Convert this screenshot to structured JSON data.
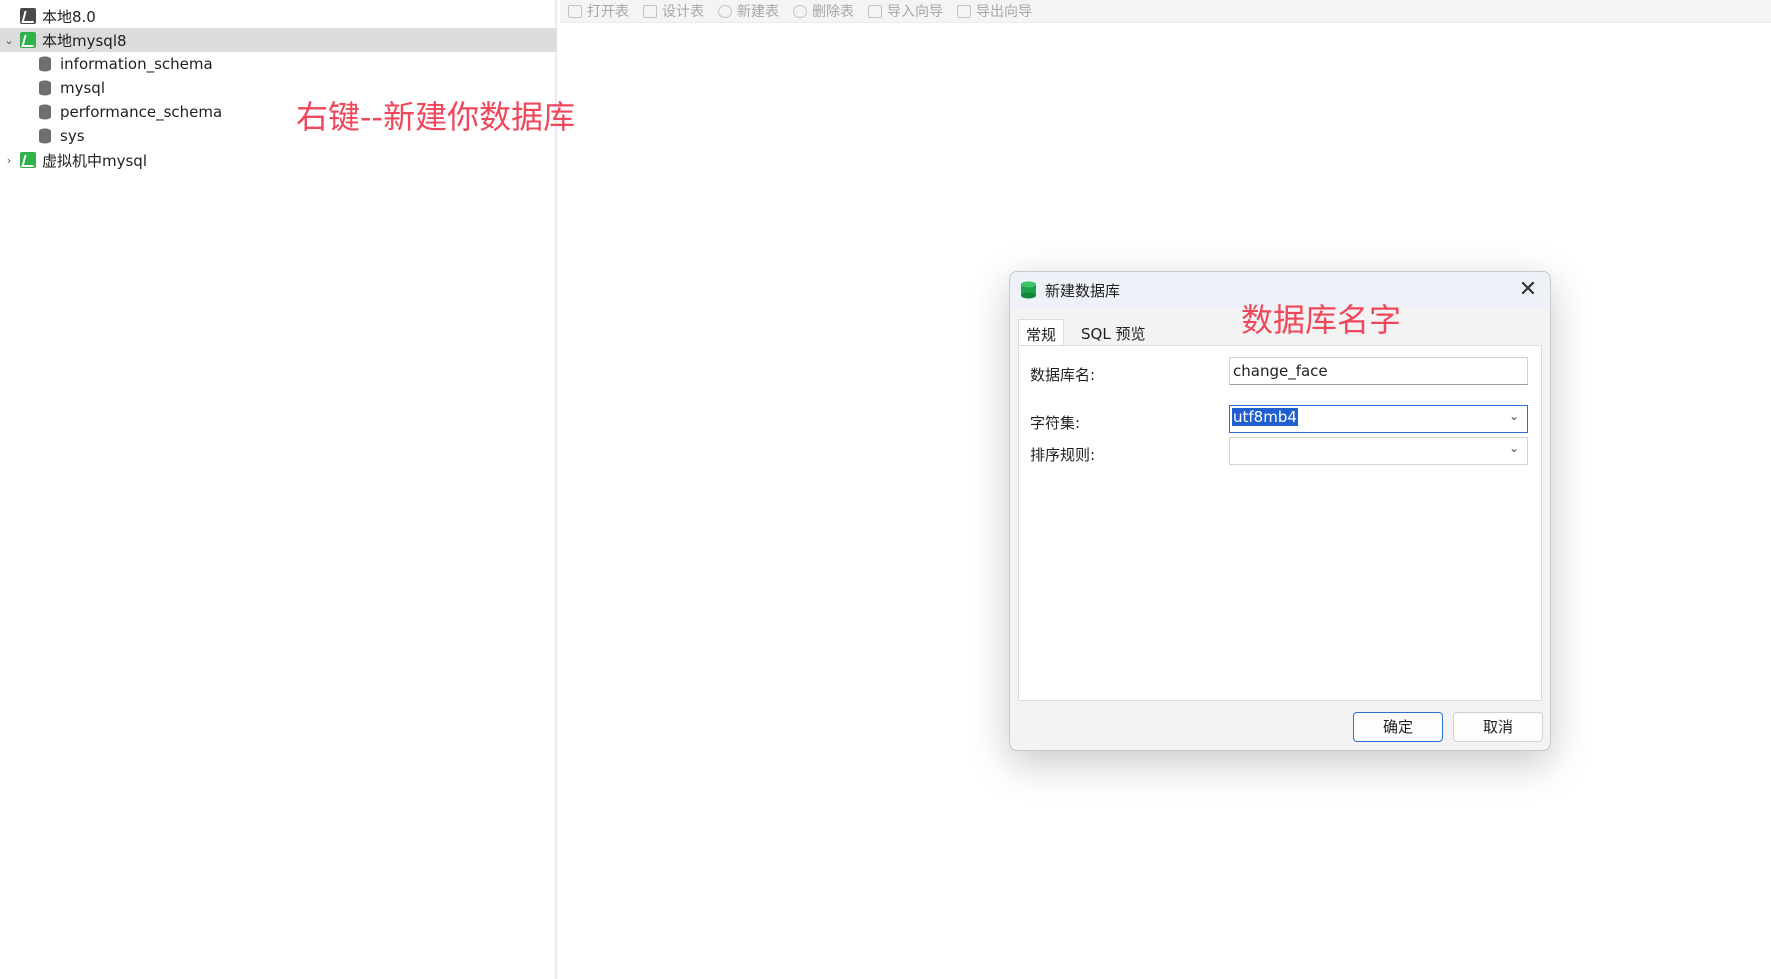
{
  "tree": {
    "connections": [
      {
        "label": "本地8.0",
        "expanded": false,
        "selected": false,
        "icon": "connection-icon-gray"
      },
      {
        "label": "本地mysql8",
        "expanded": true,
        "selected": true,
        "icon": "connection-icon-green"
      },
      {
        "label": "虚拟机中mysql",
        "expanded": false,
        "selected": false,
        "icon": "connection-icon-green"
      }
    ],
    "databases": [
      {
        "label": "information_schema",
        "icon": "database-icon"
      },
      {
        "label": "mysql",
        "icon": "database-icon"
      },
      {
        "label": "performance_schema",
        "icon": "database-icon"
      },
      {
        "label": "sys",
        "icon": "database-icon"
      }
    ]
  },
  "toolbar": {
    "items": [
      {
        "label": "打开表",
        "icon": "folder-icon"
      },
      {
        "label": "设计表",
        "icon": "pencil-icon"
      },
      {
        "label": "新建表",
        "icon": "plus-circle-icon"
      },
      {
        "label": "删除表",
        "icon": "minus-circle-icon"
      },
      {
        "label": "导入向导",
        "icon": "import-icon"
      },
      {
        "label": "导出向导",
        "icon": "export-icon"
      }
    ]
  },
  "annotations": {
    "left": "右键--新建你数据库",
    "dialog": "数据库名字"
  },
  "dialog": {
    "title": "新建数据库",
    "tabs": [
      {
        "label": "常规",
        "active": true
      },
      {
        "label": "SQL 预览",
        "active": false
      }
    ],
    "fields": {
      "name_label": "数据库名:",
      "name_value": "change_face",
      "charset_label": "字符集:",
      "charset_value": "utf8mb4",
      "collation_label": "排序规则:",
      "collation_value": ""
    },
    "ok_label": "确定",
    "cancel_label": "取消"
  },
  "colors": {
    "annotation": "#f0475b",
    "accent": "#2a6fd6",
    "selection": "#1f5fd0",
    "connection_active": "#2db34a"
  }
}
